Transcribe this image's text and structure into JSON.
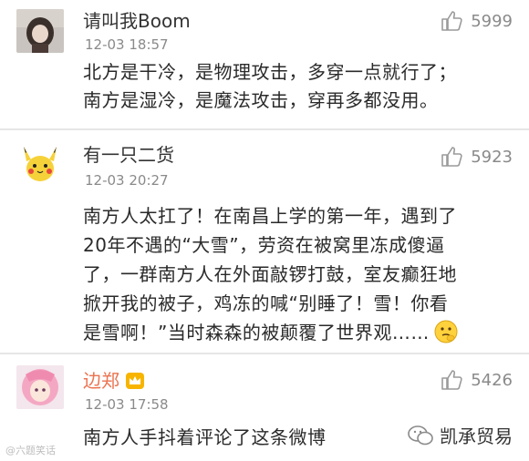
{
  "comments": [
    {
      "username": "请叫我Boom",
      "time": "12-03 18:57",
      "likes": "5999",
      "lines": [
        "北方是干冷，是物理攻击，多穿一点就行了；",
        "南方是湿冷，是魔法攻击，穿再多都没用。"
      ]
    },
    {
      "username": "有一只二货",
      "time": "12-03 20:27",
      "likes": "5923",
      "lines": [
        "南方人太扛了！在南昌上学的第一年，遇到了",
        "20年不遇的“大雪”，劳资在被窝里冻成傻逼",
        "了，一群南方人在外面敲锣打鼓，室友癫狂地",
        "掀开我的被子，鸡冻的喊“别睡了！雪！你看",
        "是雪啊！”当时森森的被颠覆了世界观……"
      ]
    },
    {
      "username": "边郑",
      "time": "12-03 17:58",
      "likes": "5426",
      "lines": [
        "南方人手抖着评论了这条微博"
      ]
    }
  ],
  "brand": {
    "label": "凯承贸易",
    "icon": "wechat-icon"
  },
  "watermark": "@六题笑话",
  "colors": {
    "vip_name": "#eb7350",
    "meta": "#8a8a8a",
    "divider": "#e6e6e6"
  }
}
